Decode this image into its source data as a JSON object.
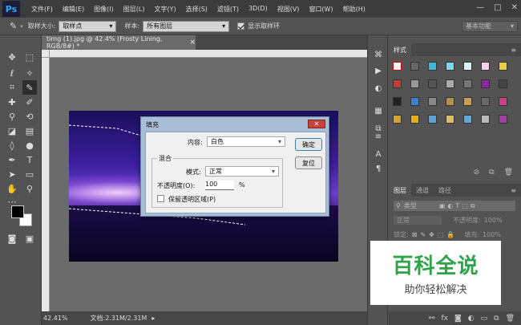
{
  "menubar": {
    "logo": "Ps",
    "items": [
      "文件(F)",
      "编辑(E)",
      "图像(I)",
      "图层(L)",
      "文字(Y)",
      "选择(S)",
      "滤镜(T)",
      "3D(D)",
      "视图(V)",
      "窗口(W)",
      "帮助(H)"
    ],
    "minimize": "—",
    "maximize": "□",
    "close": "✕"
  },
  "options": {
    "sample_size_label": "取样大小:",
    "sample_size_value": "取样点",
    "sample_label": "样本:",
    "sample_value": "所有图层",
    "show_ring_label": "显示取样环",
    "workspace": "基本功能"
  },
  "document": {
    "tab_title": "timg (1).jpg @ 42.4% (Frosty Lining, RGB/8#) *",
    "tab_close": "×",
    "zoom": "42.41%",
    "doc_size": "文档:2.31M/2.31M"
  },
  "dialog": {
    "title": "填充",
    "close": "✕",
    "content_label": "内容:",
    "content_value": "白色",
    "blend_legend": "混合",
    "mode_label": "模式:",
    "mode_value": "正常",
    "opacity_label": "不透明度(O):",
    "opacity_value": "100",
    "opacity_unit": "%",
    "preserve_label": "保留透明区域(P)",
    "ok_label": "确定",
    "reset_label": "复位"
  },
  "styles_panel": {
    "tab": "样式"
  },
  "layers_panel": {
    "tabs": [
      "图层",
      "通道",
      "路径"
    ],
    "filter_kind": "类型",
    "blend_mode": "正常",
    "opacity_label": "不透明度:",
    "opacity_value": "100%",
    "lock_label": "锁定:",
    "fill_label": "填充:",
    "fill_value": "100%"
  },
  "watermark": {
    "line1": "百科全说",
    "line2": "助你轻松解决"
  },
  "colors": {
    "accent": "#31a8ff",
    "watermark_green": "#2fa34a"
  }
}
